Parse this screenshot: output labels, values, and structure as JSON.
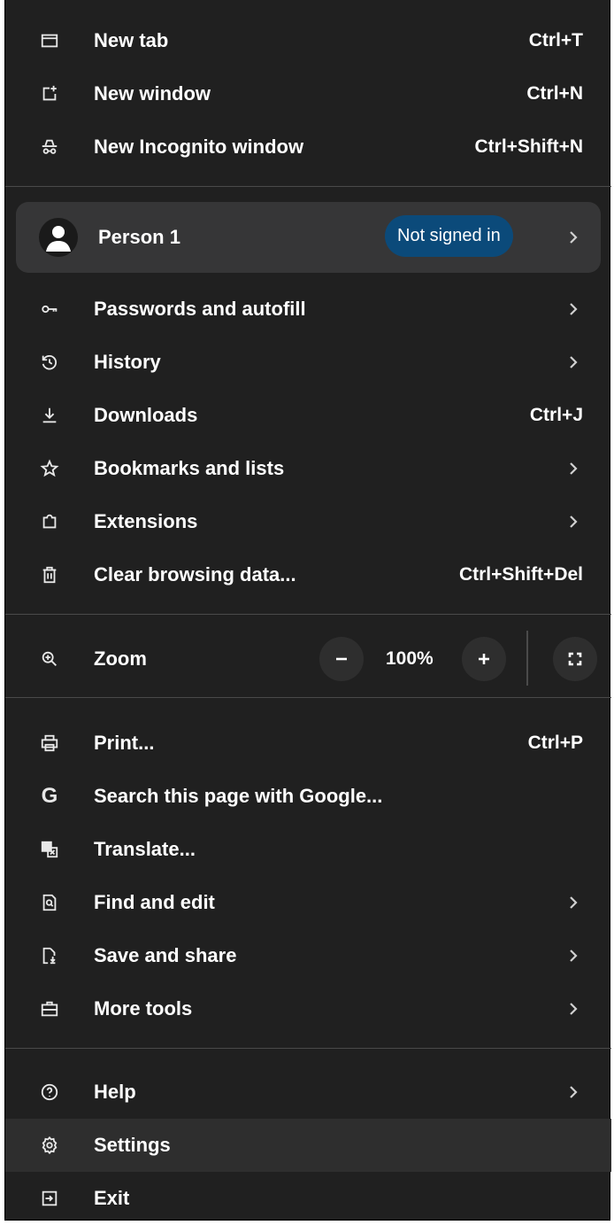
{
  "menu": {
    "new_tab": {
      "label": "New tab",
      "shortcut": "Ctrl+T",
      "icon": "new-tab-icon"
    },
    "new_window": {
      "label": "New window",
      "shortcut": "Ctrl+N",
      "icon": "new-window-icon"
    },
    "new_incognito": {
      "label": "New Incognito window",
      "shortcut": "Ctrl+Shift+N",
      "icon": "incognito-icon"
    },
    "profile": {
      "name": "Person 1",
      "status": "Not signed in",
      "icon": "avatar-icon",
      "badge_color": "#0b4a7a"
    },
    "passwords": {
      "label": "Passwords and autofill",
      "icon": "key-icon"
    },
    "history": {
      "label": "History",
      "icon": "history-icon"
    },
    "downloads": {
      "label": "Downloads",
      "shortcut": "Ctrl+J",
      "icon": "download-icon"
    },
    "bookmarks": {
      "label": "Bookmarks and lists",
      "icon": "star-icon"
    },
    "extensions": {
      "label": "Extensions",
      "icon": "puzzle-icon"
    },
    "clear_data": {
      "label": "Clear browsing data...",
      "shortcut": "Ctrl+Shift+Del",
      "icon": "trash-icon"
    },
    "zoom": {
      "label": "Zoom",
      "value": "100%",
      "icon": "zoom-icon"
    },
    "print": {
      "label": "Print...",
      "shortcut": "Ctrl+P",
      "icon": "printer-icon"
    },
    "search_google": {
      "label": "Search this page with Google...",
      "icon": "google-icon",
      "glyph": "G"
    },
    "translate": {
      "label": "Translate...",
      "icon": "translate-icon"
    },
    "find_edit": {
      "label": "Find and edit",
      "icon": "find-icon"
    },
    "save_share": {
      "label": "Save and share",
      "icon": "save-share-icon"
    },
    "more_tools": {
      "label": "More tools",
      "icon": "toolbox-icon"
    },
    "help": {
      "label": "Help",
      "icon": "help-icon"
    },
    "settings": {
      "label": "Settings",
      "icon": "gear-icon"
    },
    "exit": {
      "label": "Exit",
      "icon": "exit-icon"
    }
  },
  "colors": {
    "menu_bg": "#202020",
    "profile_bg": "#363637",
    "highlight_bg": "#2e2e2e",
    "divider": "#4a4a4a"
  }
}
